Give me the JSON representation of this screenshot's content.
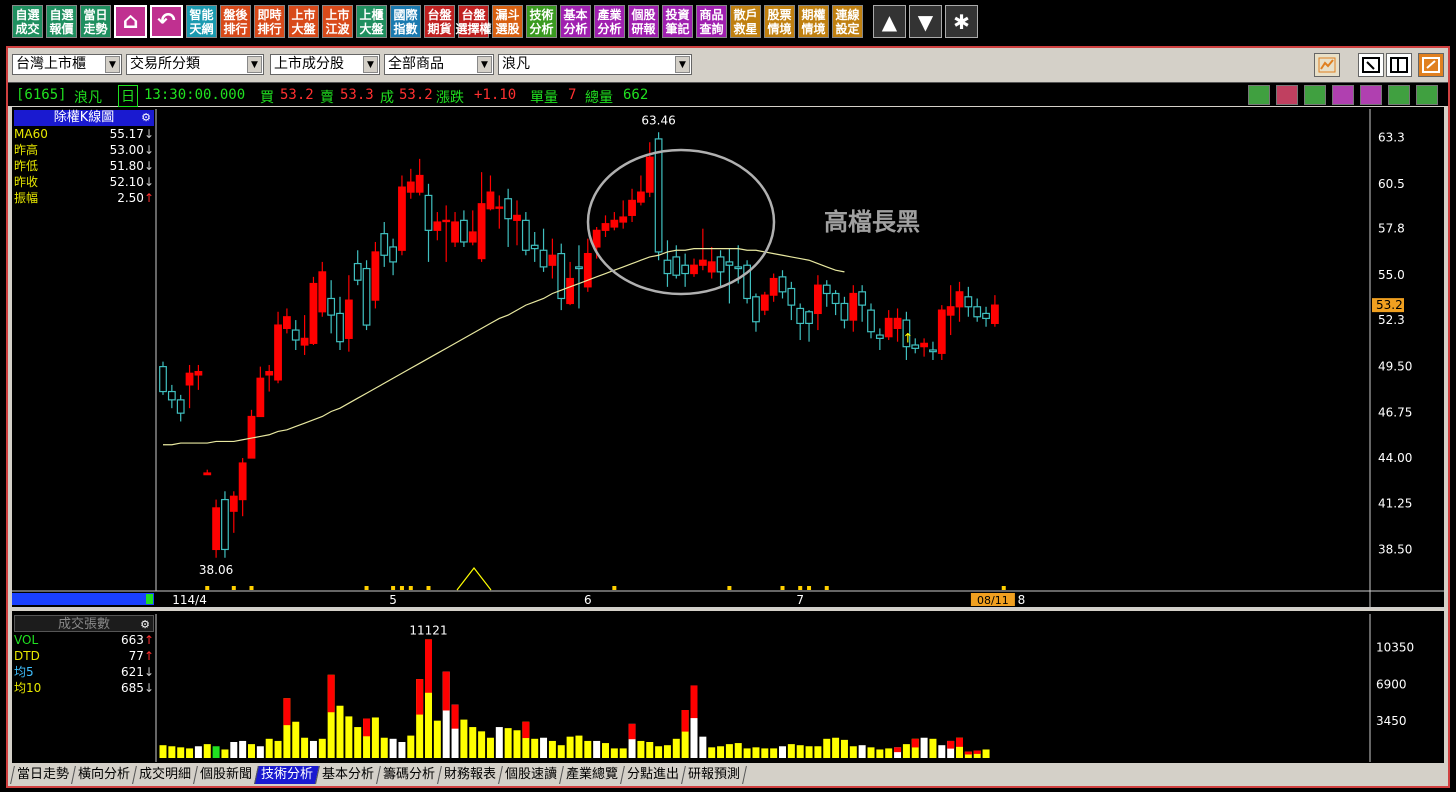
{
  "toolbar": {
    "buttons": [
      {
        "label": "自選\n成交",
        "color": "#1f8f5f"
      },
      {
        "label": "自選\n報價",
        "color": "#1f8f5f"
      },
      {
        "label": "當日\n走勢",
        "color": "#1f8f5f"
      },
      {
        "label": "",
        "color": "#c03090",
        "icon": "home-icon"
      },
      {
        "label": "",
        "color": "#c03090",
        "icon": "back-arrow-icon"
      },
      {
        "label": "智能\n天網",
        "color": "#1a9ab0"
      },
      {
        "label": "盤後\n排行",
        "color": "#d84a1a"
      },
      {
        "label": "即時\n排行",
        "color": "#d84a1a"
      },
      {
        "label": "上市\n大盤",
        "color": "#d84a1a"
      },
      {
        "label": "上市\n江波",
        "color": "#d84a1a"
      },
      {
        "label": "上櫃\n大盤",
        "color": "#1f8f5f"
      },
      {
        "label": "國際\n指數",
        "color": "#1a7ab0"
      },
      {
        "label": "台盤\n期貨",
        "color": "#c02020"
      },
      {
        "label": "台盤\n選擇權",
        "color": "#c02020"
      },
      {
        "label": "漏斗\n選股",
        "color": "#d86010"
      },
      {
        "label": "技術\n分析",
        "color": "#3a9a20"
      },
      {
        "label": "基本\n分析",
        "color": "#a020b0"
      },
      {
        "label": "產業\n分析",
        "color": "#a020b0"
      },
      {
        "label": "個股\n研報",
        "color": "#a020b0"
      },
      {
        "label": "投資\n筆記",
        "color": "#a020b0"
      },
      {
        "label": "商品\n查詢",
        "color": "#a020b0"
      },
      {
        "label": "散戶\n救星",
        "color": "#c08010"
      },
      {
        "label": "股票\n情境",
        "color": "#c08010"
      },
      {
        "label": "期權\n情境",
        "color": "#c08010"
      },
      {
        "label": "連線\n設定",
        "color": "#c08010"
      }
    ],
    "nav_icons": [
      "up-arrow-icon",
      "down-arrow-icon",
      "asterisk-icon"
    ]
  },
  "selectors": [
    {
      "value": "台灣上市櫃"
    },
    {
      "value": "交易所分類"
    },
    {
      "value": "上市成分股"
    },
    {
      "value": "全部商品"
    },
    {
      "value": "浪凡"
    }
  ],
  "quote": {
    "code": "[6165]",
    "name": "浪凡",
    "period": "日",
    "time": "13:30:00.000",
    "bid_label": "買",
    "bid": "53.2",
    "ask_label": "賣",
    "ask": "53.3",
    "deal_label": "成",
    "deal": "53.2",
    "change_label": "漲跌",
    "change": "+1.10",
    "single_vol_label": "單量",
    "single_vol": "7",
    "total_vol_label": "總量",
    "total_vol": "662"
  },
  "price_legend": {
    "title": "除權K線圖",
    "rows": [
      {
        "label": "MA60",
        "value": "55.17",
        "arrow": "↓",
        "color": "#e8e800"
      },
      {
        "label": "昨高",
        "value": "53.00",
        "arrow": "↓",
        "color": "#e8e800"
      },
      {
        "label": "昨低",
        "value": "51.80",
        "arrow": "↓",
        "color": "#e8e800"
      },
      {
        "label": "昨收",
        "value": "52.10",
        "arrow": "↓",
        "color": "#e8e800"
      },
      {
        "label": "振幅",
        "value": "2.50",
        "arrow": "↑",
        "color": "#e8e800"
      }
    ]
  },
  "vol_legend": {
    "title": "成交張數",
    "rows": [
      {
        "label": "VOL",
        "value": "663",
        "arrow": "↑",
        "color": "#20e020"
      },
      {
        "label": "DTD",
        "value": "77",
        "arrow": "↑",
        "color": "#e8e800"
      },
      {
        "label": "均5",
        "value": "621",
        "arrow": "↓",
        "color": "#40c0ff"
      },
      {
        "label": "均10",
        "value": "685",
        "arrow": "↓",
        "color": "#e8e800"
      }
    ]
  },
  "annotation": {
    "text": "高檔長黑"
  },
  "tabs": [
    "當日走勢",
    "橫向分析",
    "成交明細",
    "個股新聞",
    "技術分析",
    "基本分析",
    "籌碼分析",
    "財務報表",
    "個股速讀",
    "產業總覽",
    "分點進出",
    "研報預測"
  ],
  "active_tab": 4,
  "colors": {
    "up": "#ff0000",
    "down": "#40c0c0",
    "ma": "#e8e8a0",
    "axis": "#ffffff",
    "vol_up": "#ff0000",
    "vol_yellow": "#ffff00",
    "vol_white": "#ffffff"
  },
  "chart_data": [
    {
      "type": "candlestick",
      "title": "除權K線圖",
      "ylim": [
        36.0,
        65.0
      ],
      "y_ticks": [
        "63.3",
        "60.5",
        "57.8",
        "55.0",
        "52.3",
        "49.50",
        "46.75",
        "44.00",
        "41.25",
        "38.50"
      ],
      "x_ticks": [
        {
          "label": "114/4",
          "index": 3
        },
        {
          "label": "5",
          "index": 26
        },
        {
          "label": "6",
          "index": 48
        },
        {
          "label": "7",
          "index": 72
        },
        {
          "label": "8",
          "index": 97
        }
      ],
      "current_price_label": "53.2",
      "current_date_label": "08/11",
      "high_label": "63.46",
      "low_label": "38.06",
      "ma60": [
        44.8,
        44.8,
        44.9,
        44.9,
        44.9,
        44.9,
        45.0,
        45.0,
        45.0,
        45.1,
        45.2,
        45.3,
        45.4,
        45.6,
        45.7,
        45.9,
        46.1,
        46.3,
        46.5,
        46.8,
        47.0,
        47.3,
        47.6,
        47.9,
        48.2,
        48.5,
        48.8,
        49.1,
        49.4,
        49.7,
        50.0,
        50.3,
        50.6,
        50.9,
        51.2,
        51.5,
        51.8,
        52.1,
        52.4,
        52.6,
        52.9,
        53.2,
        53.4,
        53.6,
        53.9,
        54.1,
        54.3,
        54.5,
        54.7,
        54.9,
        55.1,
        55.3,
        55.5,
        55.7,
        55.9,
        56.1,
        56.2,
        56.4,
        56.5,
        56.5,
        56.6,
        56.6,
        56.6,
        56.6,
        56.6,
        56.6,
        56.5,
        56.5,
        56.4,
        56.3,
        56.2,
        56.1,
        56.0,
        55.9,
        55.7,
        55.5,
        55.3,
        55.2
      ],
      "candles": [
        [
          49.5,
          48.0,
          49.8,
          47.8
        ],
        [
          48.0,
          47.5,
          48.4,
          47.0
        ],
        [
          47.5,
          46.7,
          47.8,
          46.2
        ],
        [
          48.4,
          49.1,
          49.6,
          47.0
        ],
        [
          49.0,
          49.2,
          49.6,
          48.1
        ],
        [
          43.0,
          43.1,
          43.3,
          43.0
        ],
        [
          38.5,
          41.0,
          41.5,
          38.0
        ],
        [
          41.5,
          38.5,
          42.0,
          38.0
        ],
        [
          40.8,
          41.7,
          42.0,
          39.5
        ],
        [
          41.5,
          43.7,
          44.0,
          40.5
        ],
        [
          44.0,
          46.5,
          46.9,
          44.0
        ],
        [
          46.5,
          48.8,
          49.5,
          46.5
        ],
        [
          49.0,
          49.2,
          49.6,
          48.0
        ],
        [
          48.7,
          52.0,
          52.8,
          48.5
        ],
        [
          51.8,
          52.5,
          53.0,
          51.5
        ],
        [
          51.7,
          51.1,
          52.3,
          50.5
        ],
        [
          50.8,
          51.2,
          52.6,
          50.2
        ],
        [
          50.9,
          54.5,
          54.9,
          50.8
        ],
        [
          52.8,
          55.2,
          55.8,
          52.5
        ],
        [
          53.6,
          52.6,
          54.7,
          51.5
        ],
        [
          52.7,
          51.0,
          53.7,
          50.5
        ],
        [
          51.2,
          53.5,
          55.0,
          50.4
        ],
        [
          55.7,
          54.7,
          56.5,
          54.4
        ],
        [
          55.4,
          52.0,
          55.9,
          51.7
        ],
        [
          53.5,
          56.4,
          57.0,
          53.0
        ],
        [
          57.5,
          56.2,
          58.2,
          55.5
        ],
        [
          56.7,
          55.8,
          57.2,
          55.0
        ],
        [
          56.5,
          60.3,
          61.0,
          56.2
        ],
        [
          60.0,
          60.6,
          61.4,
          59.6
        ],
        [
          60.0,
          61.0,
          62.0,
          59.8
        ],
        [
          59.8,
          57.7,
          60.5,
          55.8
        ],
        [
          57.7,
          58.2,
          58.8,
          57.1
        ],
        [
          58.3,
          58.3,
          59.2,
          55.8
        ],
        [
          57.0,
          58.2,
          58.8,
          56.7
        ],
        [
          58.3,
          57.0,
          58.9,
          56.7
        ],
        [
          57.0,
          57.6,
          58.9,
          56.8
        ],
        [
          56.0,
          59.3,
          61.2,
          55.8
        ],
        [
          59.0,
          60.0,
          61.0,
          58.9
        ],
        [
          59.1,
          59.1,
          59.8,
          57.8
        ],
        [
          59.6,
          58.4,
          60.2,
          56.7
        ],
        [
          58.3,
          58.6,
          59.5,
          56.8
        ],
        [
          58.3,
          56.5,
          58.8,
          56.2
        ],
        [
          56.8,
          56.6,
          57.6,
          55.8
        ],
        [
          56.5,
          55.5,
          57.8,
          55.2
        ],
        [
          55.6,
          56.2,
          57.2,
          54.8
        ],
        [
          56.3,
          53.6,
          56.9,
          52.9
        ],
        [
          53.3,
          54.8,
          55.8,
          53.2
        ],
        [
          55.5,
          55.4,
          56.8,
          53.0
        ],
        [
          54.3,
          56.3,
          57.2,
          54.0
        ],
        [
          56.7,
          57.7,
          57.9,
          56.0
        ],
        [
          57.7,
          58.1,
          58.6,
          57.3
        ],
        [
          57.9,
          58.3,
          58.8,
          57.7
        ],
        [
          58.2,
          58.5,
          59.5,
          57.8
        ],
        [
          58.6,
          59.5,
          60.2,
          58.2
        ],
        [
          59.4,
          60.0,
          61.0,
          59.2
        ],
        [
          60.0,
          62.1,
          63.0,
          59.7
        ],
        [
          63.2,
          56.4,
          63.6,
          55.9
        ],
        [
          55.9,
          55.1,
          57.1,
          54.3
        ],
        [
          56.1,
          55.0,
          56.8,
          54.8
        ],
        [
          55.6,
          55.1,
          56.3,
          54.3
        ],
        [
          55.1,
          55.6,
          56.0,
          54.9
        ],
        [
          55.6,
          55.9,
          57.8,
          55.3
        ],
        [
          55.2,
          55.8,
          56.7,
          54.8
        ],
        [
          56.1,
          55.2,
          56.5,
          54.3
        ],
        [
          55.8,
          55.6,
          56.6,
          53.3
        ],
        [
          55.5,
          55.4,
          56.8,
          54.5
        ],
        [
          55.6,
          53.6,
          55.9,
          53.3
        ],
        [
          53.7,
          52.2,
          53.9,
          51.6
        ],
        [
          52.9,
          53.8,
          54.0,
          52.6
        ],
        [
          53.8,
          54.8,
          55.1,
          53.4
        ],
        [
          54.9,
          54.0,
          55.3,
          53.6
        ],
        [
          54.2,
          53.2,
          54.6,
          52.3
        ],
        [
          53.0,
          52.1,
          53.3,
          51.1
        ],
        [
          52.8,
          52.1,
          52.9,
          51.0
        ],
        [
          52.7,
          54.4,
          55.0,
          51.7
        ],
        [
          54.4,
          53.9,
          54.7,
          53.1
        ],
        [
          53.9,
          53.3,
          54.1,
          52.6
        ],
        [
          53.3,
          52.3,
          53.7,
          51.8
        ],
        [
          52.3,
          53.9,
          54.4,
          51.6
        ],
        [
          54.0,
          53.2,
          54.4,
          52.2
        ],
        [
          52.9,
          51.6,
          53.3,
          51.2
        ],
        [
          51.4,
          51.2,
          51.8,
          50.5
        ],
        [
          51.3,
          52.4,
          52.9,
          51.1
        ],
        [
          51.8,
          52.4,
          53.0,
          51.0
        ],
        [
          52.3,
          50.7,
          52.8,
          49.9
        ],
        [
          50.8,
          50.6,
          51.2,
          50.3
        ],
        [
          50.7,
          50.9,
          51.2,
          50.1
        ],
        [
          50.5,
          50.4,
          51.0,
          49.9
        ],
        [
          50.3,
          52.9,
          53.2,
          49.9
        ],
        [
          52.6,
          53.1,
          54.4,
          51.4
        ],
        [
          53.1,
          54.0,
          54.6,
          52.2
        ],
        [
          53.7,
          53.1,
          54.3,
          52.5
        ],
        [
          53.1,
          52.5,
          53.6,
          52.2
        ],
        [
          52.7,
          52.4,
          53.1,
          51.9
        ],
        [
          52.1,
          53.2,
          53.8,
          51.9
        ]
      ]
    },
    {
      "type": "bar",
      "title": "成交張數",
      "ylim": [
        0,
        13500
      ],
      "y_ticks": [
        "10350",
        "6900",
        "3450"
      ],
      "max_label": "11121",
      "values": [
        1200,
        1100,
        1000,
        900,
        1100,
        1300,
        1100,
        800,
        1500,
        1600,
        1300,
        1100,
        1800,
        1600,
        5600,
        3400,
        1900,
        1600,
        1800,
        7800,
        4900,
        3900,
        2900,
        3700,
        3800,
        1900,
        1800,
        1500,
        2100,
        7400,
        11121,
        3500,
        8100,
        5000,
        3600,
        2900,
        2500,
        1900,
        2900,
        2800,
        2600,
        3400,
        1800,
        1900,
        1600,
        1200,
        2000,
        2100,
        1600,
        1600,
        1400,
        900,
        900,
        3200,
        1600,
        1500,
        1100,
        1200,
        1800,
        4500,
        6800,
        2000,
        1000,
        1100,
        1300,
        1400,
        900,
        1000,
        900,
        900,
        1100,
        1300,
        1200,
        1100,
        1100,
        1800,
        1900,
        1700,
        1100,
        1200,
        1000,
        800,
        900,
        1000,
        1300,
        1800,
        1900,
        1800,
        1200,
        1600,
        1900,
        600,
        700,
        800
      ],
      "up_color_indices": [
        14,
        19,
        23,
        29,
        30,
        32,
        33,
        41,
        53,
        59,
        60,
        83,
        85,
        89,
        90,
        91,
        92
      ],
      "white_indices": [
        4,
        8,
        9,
        11,
        17,
        26,
        27,
        32,
        33,
        38,
        43,
        49,
        53,
        60,
        61,
        70,
        79,
        83,
        86,
        88,
        89
      ],
      "green_indices": [
        6
      ]
    }
  ]
}
